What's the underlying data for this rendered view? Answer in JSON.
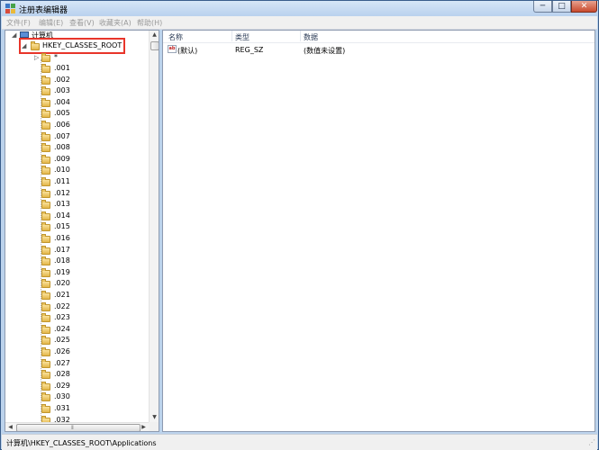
{
  "window": {
    "title": "注册表编辑器",
    "buttons": {
      "minimize": "─",
      "maximize": "□",
      "close": "✕"
    }
  },
  "menu": [
    "文件(F)",
    "编辑(E)",
    "查看(V)",
    "收藏夹(A)",
    "帮助(H)"
  ],
  "tree": {
    "root_expander": "◢",
    "root_label": "计算机",
    "hive_expander": "◢",
    "hive_label": "HKEY_CLASSES_ROOT",
    "first_expander": "▷",
    "first_label": "*",
    "keys": [
      ".001",
      ".002",
      ".003",
      ".004",
      ".005",
      ".006",
      ".007",
      ".008",
      ".009",
      ".010",
      ".011",
      ".012",
      ".013",
      ".014",
      ".015",
      ".016",
      ".017",
      ".018",
      ".019",
      ".020",
      ".021",
      ".022",
      ".023",
      ".024",
      ".025",
      ".026",
      ".027",
      ".028",
      ".029",
      ".030",
      ".031",
      ".032"
    ]
  },
  "list": {
    "columns": [
      "名称",
      "类型",
      "数据"
    ],
    "rows": [
      {
        "icon": "string-value-icon",
        "icon_text": "ab",
        "name": "(默认)",
        "type": "REG_SZ",
        "data": "(数值未设置)"
      }
    ]
  },
  "statusbar": {
    "path": "计算机\\HKEY_CLASSES_ROOT\\Applications"
  },
  "colors": {
    "highlight_box": "#e8352a",
    "folder": "#e3b64a"
  }
}
